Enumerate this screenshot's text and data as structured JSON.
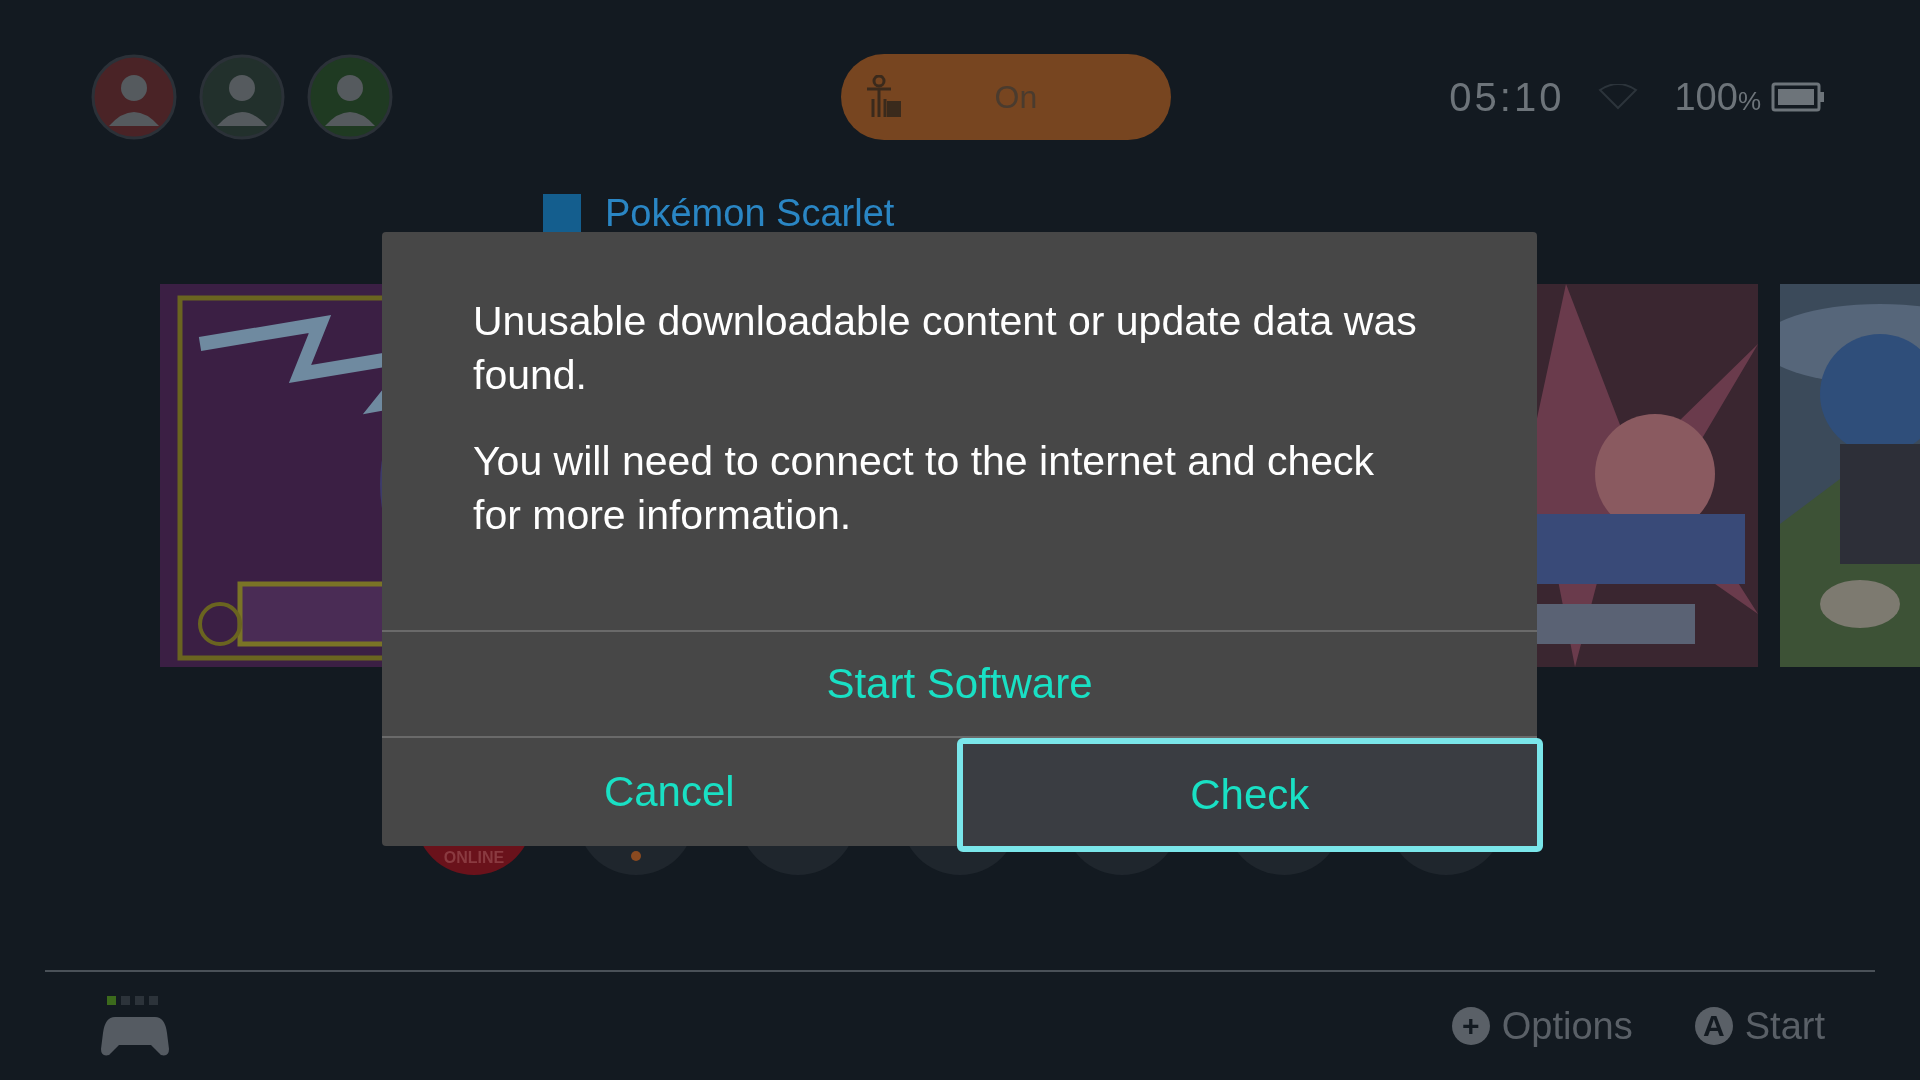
{
  "status_bar": {
    "parental_control": {
      "label": "On"
    },
    "time": "05:10",
    "battery": "100",
    "battery_unit": "%"
  },
  "selected_game": {
    "title": "Pokémon Scarlet"
  },
  "shortcuts": [
    {
      "kind": "online",
      "label": "ONLINE"
    },
    {
      "kind": "news"
    },
    {
      "kind": "plain"
    },
    {
      "kind": "plain"
    },
    {
      "kind": "plain"
    },
    {
      "kind": "plain"
    },
    {
      "kind": "plain"
    }
  ],
  "dialog": {
    "message": [
      "Unusable downloadable content or update data was found.",
      "You will need to connect to the internet and check for more information."
    ],
    "buttons": [
      {
        "label": "Start Software",
        "selected": false
      },
      {
        "label": "Cancel",
        "selected": false
      },
      {
        "label": "Check",
        "selected": true
      }
    ]
  },
  "footer": {
    "hints": [
      {
        "glyph": "+",
        "label": "Options"
      },
      {
        "glyph": "A",
        "label": "Start"
      }
    ]
  }
}
